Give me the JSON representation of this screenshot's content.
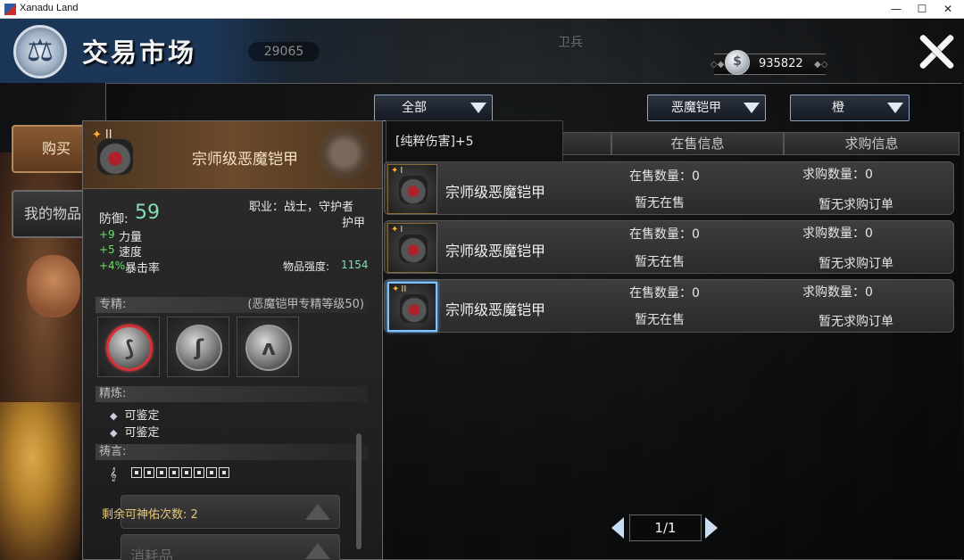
{
  "window": {
    "title": "Xanadu Land",
    "minimize": "—",
    "maximize": "☐",
    "close": "✕"
  },
  "header": {
    "title": "交易市场",
    "currency_value": "935822",
    "bg_number": "29065",
    "bg_guard": "卫兵"
  },
  "sidebar": {
    "buy_label": "购买",
    "my_items_label": "我的物品"
  },
  "filters": {
    "category": "全部",
    "type": "恶魔铠甲",
    "quality": "橙"
  },
  "columns": {
    "on_sale": "在售信息",
    "wanted": "求购信息"
  },
  "rows": [
    {
      "grade": "I",
      "name": "宗师级恶魔铠甲",
      "on_sale_count": "在售数量：0",
      "on_sale_status": "暂无在售",
      "wanted_count": "求购数量：0",
      "wanted_status": "暂无求购订单"
    },
    {
      "grade": "I",
      "name": "宗师级恶魔铠甲",
      "on_sale_count": "在售数量：0",
      "on_sale_status": "暂无在售",
      "wanted_count": "求购数量：0",
      "wanted_status": "暂无求购订单"
    },
    {
      "grade": "II",
      "name": "宗师级恶魔铠甲",
      "on_sale_count": "在售数量：0",
      "on_sale_status": "暂无在售",
      "wanted_count": "求购数量：0",
      "wanted_status": "暂无求购订单"
    }
  ],
  "popup": {
    "text": "[纯粹伤害]+5"
  },
  "tooltip": {
    "grade": "II",
    "name": "宗师级恶魔铠甲",
    "defense_label": "防御:",
    "defense_value": "59",
    "job_line1": "职业：战士，守护者",
    "job_line2": "护甲",
    "stats": [
      {
        "value": "+9",
        "name": "力量"
      },
      {
        "value": "+5",
        "name": "速度"
      },
      {
        "value": "+4%",
        "name": "暴击率"
      }
    ],
    "strength_label": "物品强度:",
    "strength_value": "1154",
    "spec_label": "专精:",
    "spec_note": "(恶魔铠甲专精等级50)",
    "refine_label": "精炼:",
    "refine_items": [
      "可鉴定",
      "可鉴定"
    ],
    "prayer_label": "祷言:",
    "blessing_text": "剩余可神佑次数: 2",
    "consumable_label": "消耗品"
  },
  "pager": {
    "text": "1/1"
  }
}
